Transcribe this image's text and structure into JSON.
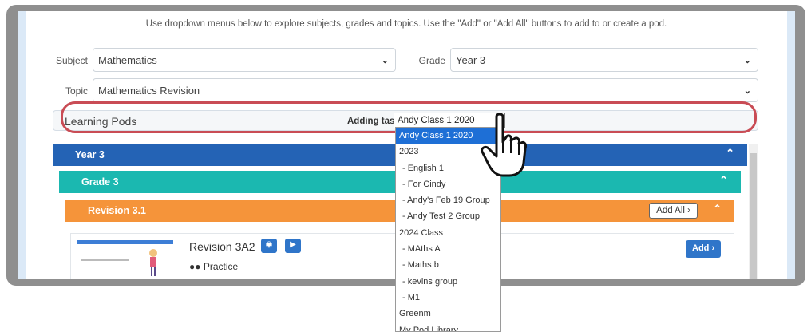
{
  "instructions": "Use dropdown menus below to explore subjects, grades and topics. Use the \"Add\" or \"Add All\" buttons to add to or create a pod.",
  "filters": {
    "subject_label": "Subject",
    "subject_value": "Mathematics",
    "grade_label": "Grade",
    "grade_value": "Year 3",
    "topic_label": "Topic",
    "topic_value": "Mathematics Revision"
  },
  "pods": {
    "title": "Learning Pods",
    "adding_label": "Adding tasks for",
    "selected_class": "Andy Class 1 2020",
    "options": [
      {
        "label": "Andy Class 1 2020",
        "selected": true
      },
      {
        "label": "2023"
      },
      {
        "label": "- English 1"
      },
      {
        "label": "- For Cindy"
      },
      {
        "label": "- Andy's Feb 19 Group"
      },
      {
        "label": "- Andy Test 2 Group"
      },
      {
        "label": "2024 Class"
      },
      {
        "label": "- MAths A"
      },
      {
        "label": "- Maths b"
      },
      {
        "label": "- kevins group"
      },
      {
        "label": "- M1"
      },
      {
        "label": "Greenm"
      },
      {
        "label": "My Pod Library"
      }
    ]
  },
  "sections": {
    "year": "Year 3",
    "grade": "Grade 3",
    "revision": "Revision 3.1",
    "add_all": "Add All"
  },
  "task": {
    "title": "Revision 3A2",
    "type": "Practice",
    "add": "Add"
  },
  "colors": {
    "year_bar": "#2463b5",
    "grade_bar": "#1bb8b0",
    "revision_bar": "#f5943a",
    "highlight": "#c94c55",
    "selected_option": "#1e6fd6"
  }
}
